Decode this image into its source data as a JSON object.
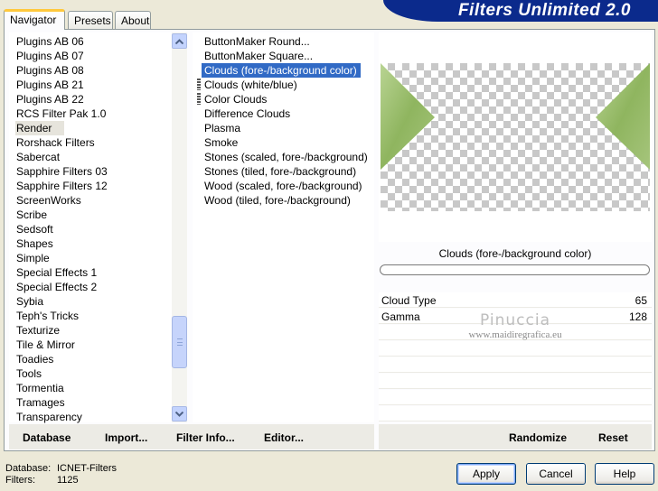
{
  "tabs": [
    {
      "label": "Navigator",
      "active": true
    },
    {
      "label": "Presets",
      "active": false
    },
    {
      "label": "About",
      "active": false
    }
  ],
  "banner": {
    "title": "Filters Unlimited 2.0",
    "color": "#0b2a8c"
  },
  "categories": {
    "items": [
      "Plugins AB 06",
      "Plugins AB 07",
      "Plugins AB 08",
      "Plugins AB 21",
      "Plugins AB 22",
      "RCS Filter Pak 1.0",
      "Render",
      "Rorshack Filters",
      "Sabercat",
      "Sapphire Filters 03",
      "Sapphire Filters 12",
      "ScreenWorks",
      "Scribe",
      "Sedsoft",
      "Shapes",
      "Simple",
      "Special Effects 1",
      "Special Effects 2",
      "Sybia",
      "Teph's Tricks",
      "Texturize",
      "Tile & Mirror",
      "Toadies",
      "Tools",
      "Tormentia",
      "Tramages",
      "Transparency"
    ],
    "selected": "Render",
    "scroll_position": 0.78
  },
  "filters": {
    "items": [
      "ButtonMaker Round...",
      "ButtonMaker Square...",
      "Clouds (fore-/background color)",
      "Clouds (white/blue)",
      "Color Clouds",
      "Difference Clouds",
      "Plasma",
      "Smoke",
      "Stones (scaled, fore-/background)",
      "Stones (tiled, fore-/background)",
      "Wood (scaled, fore-/background)",
      "Wood (tiled, fore-/background)"
    ],
    "selected": "Clouds (fore-/background color)",
    "selection_color": "#316ac5"
  },
  "preview": {
    "label": "Clouds (fore-/background color)",
    "accent_color": "#9fbf72"
  },
  "params": [
    {
      "name": "Cloud Type",
      "value": "65"
    },
    {
      "name": "Gamma",
      "value": "128"
    }
  ],
  "watermark": {
    "title": "Pinuccia",
    "url": "www.maidiregrafica.eu"
  },
  "bar": {
    "database_label": "Database",
    "import_label": "Import...",
    "filter_info_label": "Filter Info...",
    "editor_label": "Editor...",
    "randomize_label": "Randomize",
    "reset_label": "Reset"
  },
  "status": {
    "database_label": "Database:",
    "database_value": "ICNET-Filters",
    "filters_label": "Filters:",
    "filters_value": "1125"
  },
  "dialog": {
    "apply_label": "Apply",
    "cancel_label": "Cancel",
    "help_label": "Help"
  }
}
